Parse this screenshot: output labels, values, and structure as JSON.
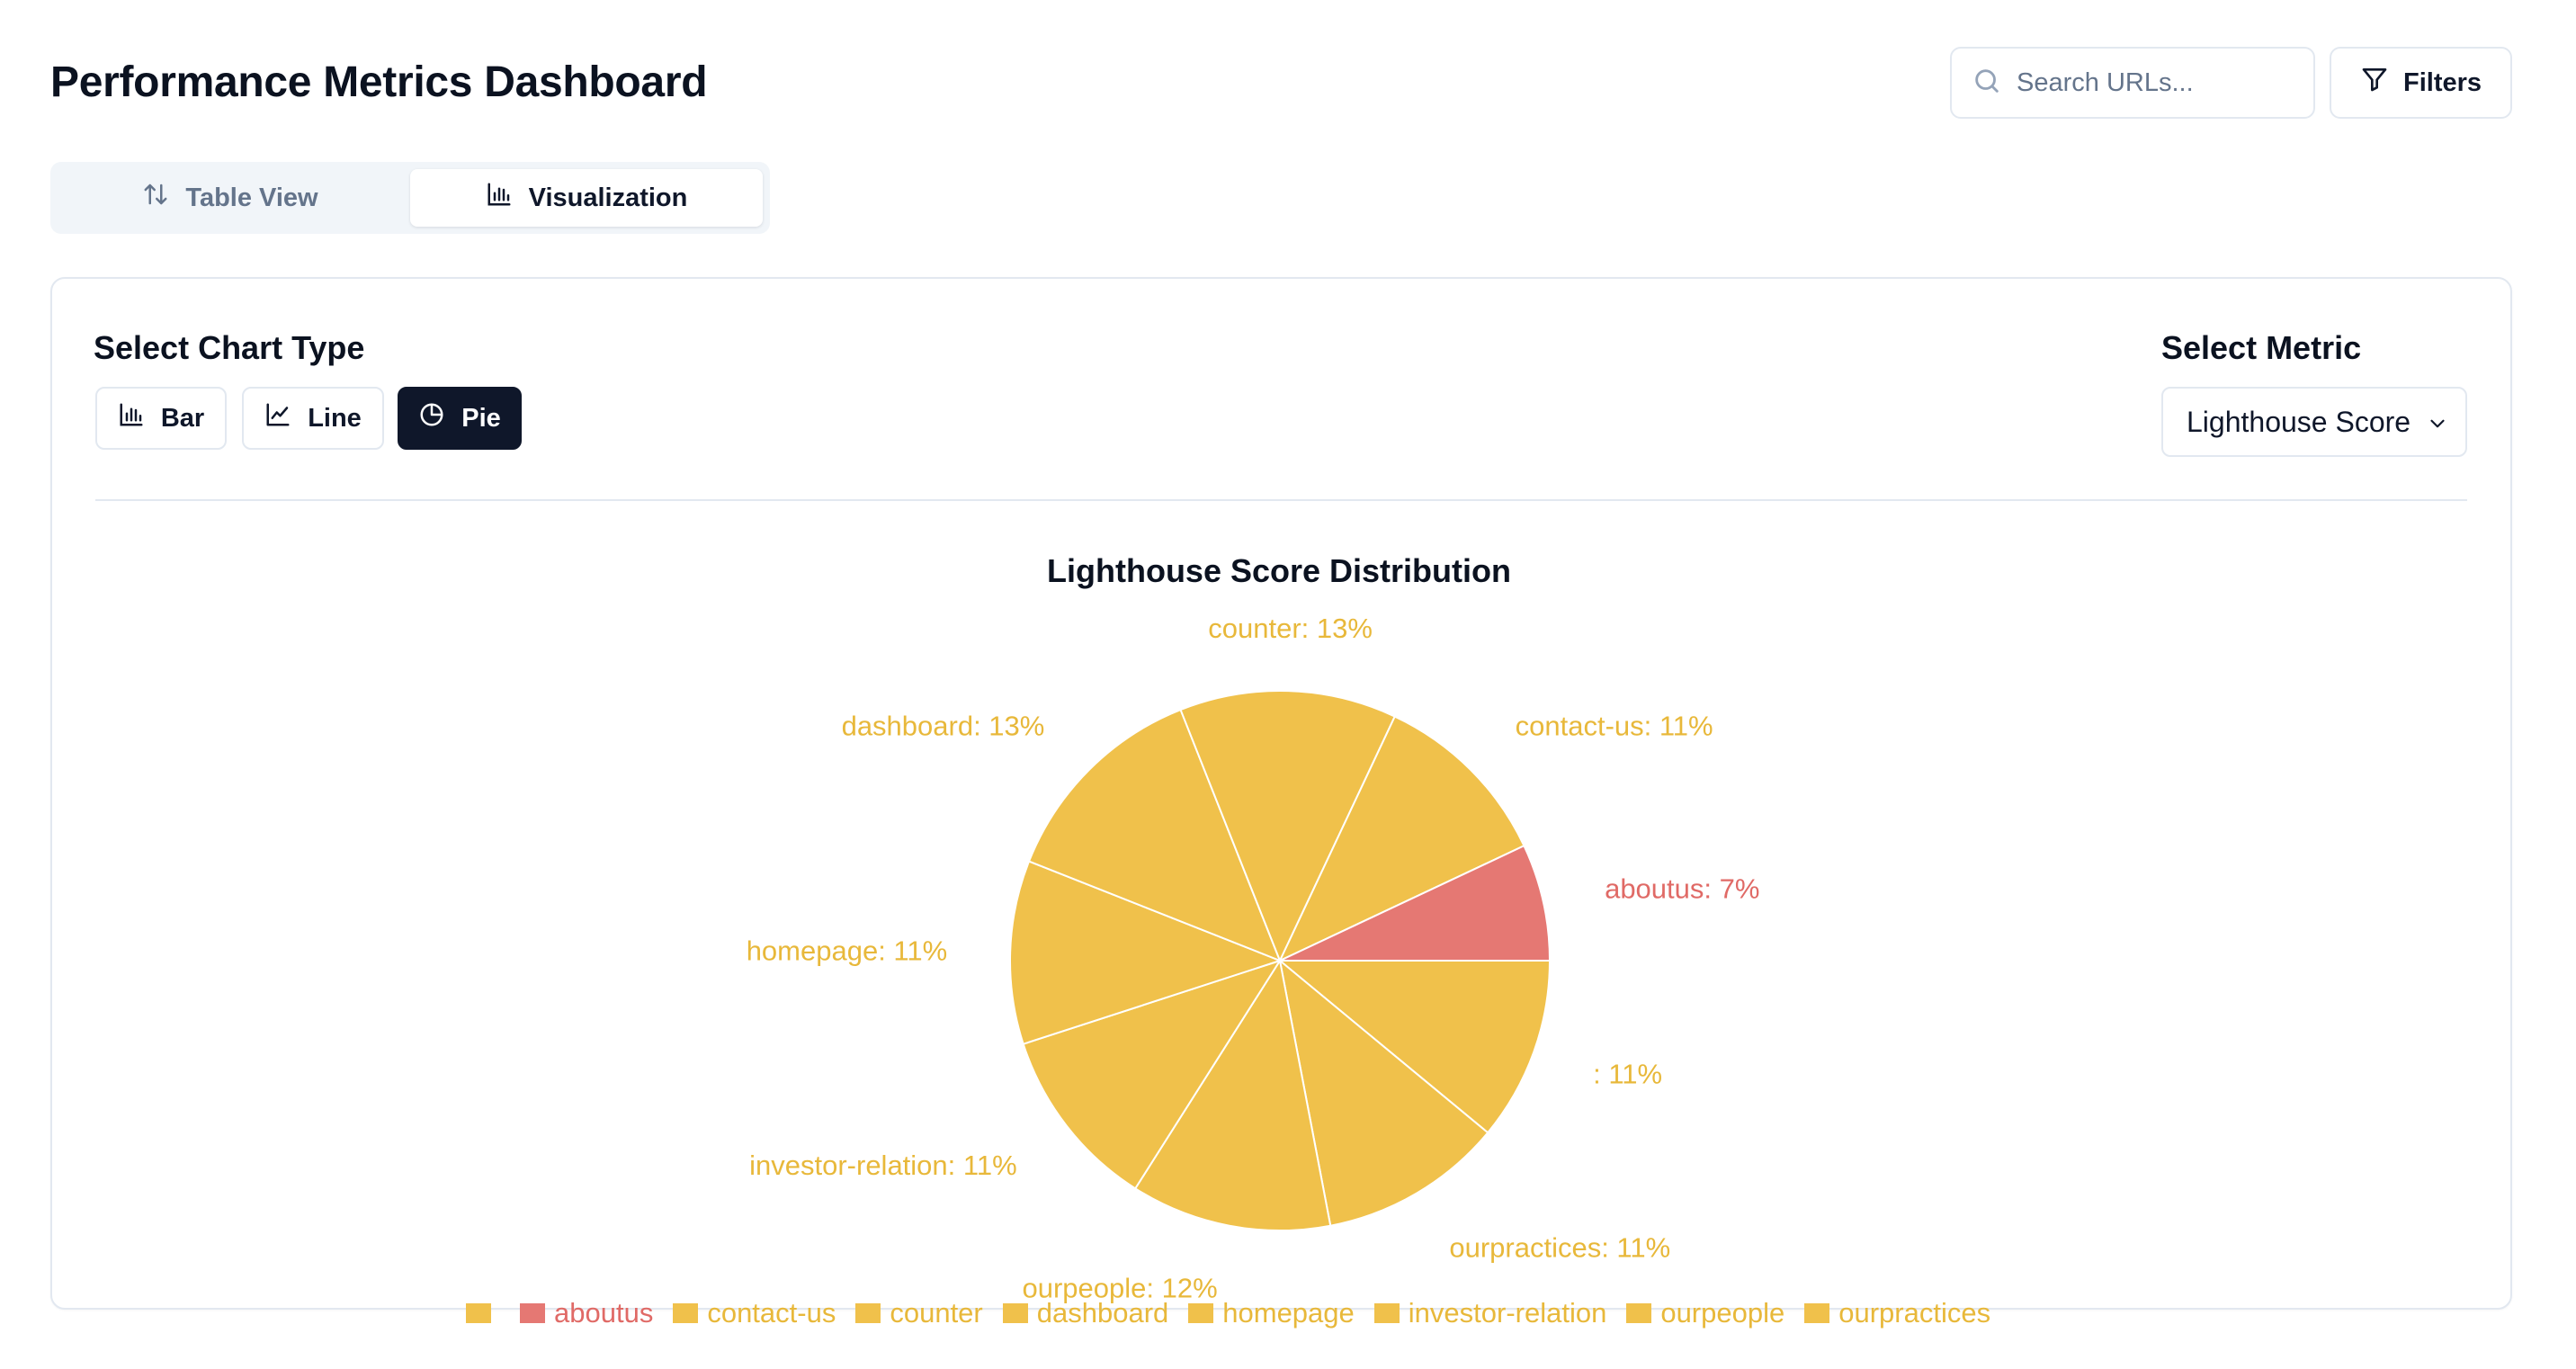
{
  "header": {
    "title": "Performance Metrics Dashboard",
    "search_placeholder": "Search URLs...",
    "filters_label": "Filters"
  },
  "view_tabs": [
    {
      "label": "Table View",
      "icon": "sort-arrows-icon",
      "active": false
    },
    {
      "label": "Visualization",
      "icon": "bar-chart-icon",
      "active": true
    }
  ],
  "controls": {
    "chart_type_label": "Select Chart Type",
    "chart_types": [
      {
        "label": "Bar",
        "icon": "bar-chart-icon",
        "active": false
      },
      {
        "label": "Line",
        "icon": "line-chart-icon",
        "active": false
      },
      {
        "label": "Pie",
        "icon": "pie-chart-icon",
        "active": true
      }
    ],
    "metric_label": "Select Metric",
    "metric_value": "Lighthouse Score"
  },
  "colors": {
    "accent_dark": "#0f172a",
    "slice_default": "#f0c14b",
    "slice_low": "#e57873",
    "label_default": "#e8b83a",
    "label_low": "#e06a66"
  },
  "chart_data": {
    "type": "pie",
    "title": "Lighthouse Score Distribution",
    "slices": [
      {
        "name": "",
        "label": ": 11%",
        "percent": 11,
        "color": "#f0c14b"
      },
      {
        "name": "ourpractices",
        "label": "ourpractices: 11%",
        "percent": 11,
        "color": "#f0c14b"
      },
      {
        "name": "ourpeople",
        "label": "ourpeople: 12%",
        "percent": 12,
        "color": "#f0c14b"
      },
      {
        "name": "investor-relation",
        "label": "investor-relation: 11%",
        "percent": 11,
        "color": "#f0c14b"
      },
      {
        "name": "homepage",
        "label": "homepage: 11%",
        "percent": 11,
        "color": "#f0c14b"
      },
      {
        "name": "dashboard",
        "label": "dashboard: 13%",
        "percent": 13,
        "color": "#f0c14b"
      },
      {
        "name": "counter",
        "label": "counter: 13%",
        "percent": 13,
        "color": "#f0c14b"
      },
      {
        "name": "contact-us",
        "label": "contact-us: 11%",
        "percent": 11,
        "color": "#f0c14b"
      },
      {
        "name": "aboutus",
        "label": "aboutus: 7%",
        "percent": 7,
        "color": "#e57873"
      }
    ],
    "legend": [
      "",
      "aboutus",
      "contact-us",
      "counter",
      "dashboard",
      "homepage",
      "investor-relation",
      "ourpeople",
      "ourpractices"
    ],
    "legend_placement": "bottom"
  }
}
